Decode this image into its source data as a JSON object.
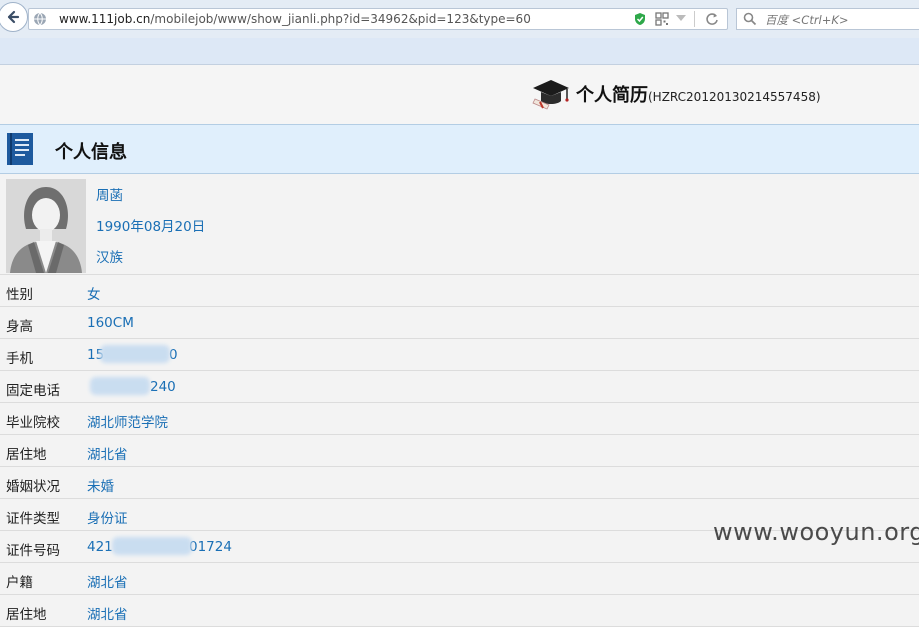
{
  "browser": {
    "url_host": "www.111job.cn",
    "url_path": "/mobilejob/www/show_jianli.php?id=34962&pid=123&type=60",
    "search_placeholder": "百度 <Ctrl+K>"
  },
  "page": {
    "title": "个人简历",
    "resume_code": "(HZRC20120130214557458)",
    "section_title": "个人信息"
  },
  "profile": {
    "name": "周菡",
    "birthdate": "1990年08月20日",
    "ethnicity": "汉族"
  },
  "fields": [
    {
      "label": "性别",
      "value": "女"
    },
    {
      "label": "身高",
      "value": "160CM"
    },
    {
      "label": "手机",
      "value_start": "15",
      "value_end": "0"
    },
    {
      "label": "固定电话",
      "value_start": "",
      "value_end": "240"
    },
    {
      "label": "毕业院校",
      "value": "湖北师范学院"
    },
    {
      "label": "居住地",
      "value": "湖北省"
    },
    {
      "label": "婚姻状况",
      "value": "未婚"
    },
    {
      "label": "证件类型",
      "value": "身份证"
    },
    {
      "label": "证件号码",
      "value_start": "421",
      "value_end": "01724"
    },
    {
      "label": "户籍",
      "value": "湖北省"
    },
    {
      "label": "居住地",
      "value": "湖北省"
    }
  ],
  "watermark": "www.wooyun.org",
  "colors": {
    "link_blue": "#1a6fb5",
    "section_bg": "#e0effc"
  }
}
